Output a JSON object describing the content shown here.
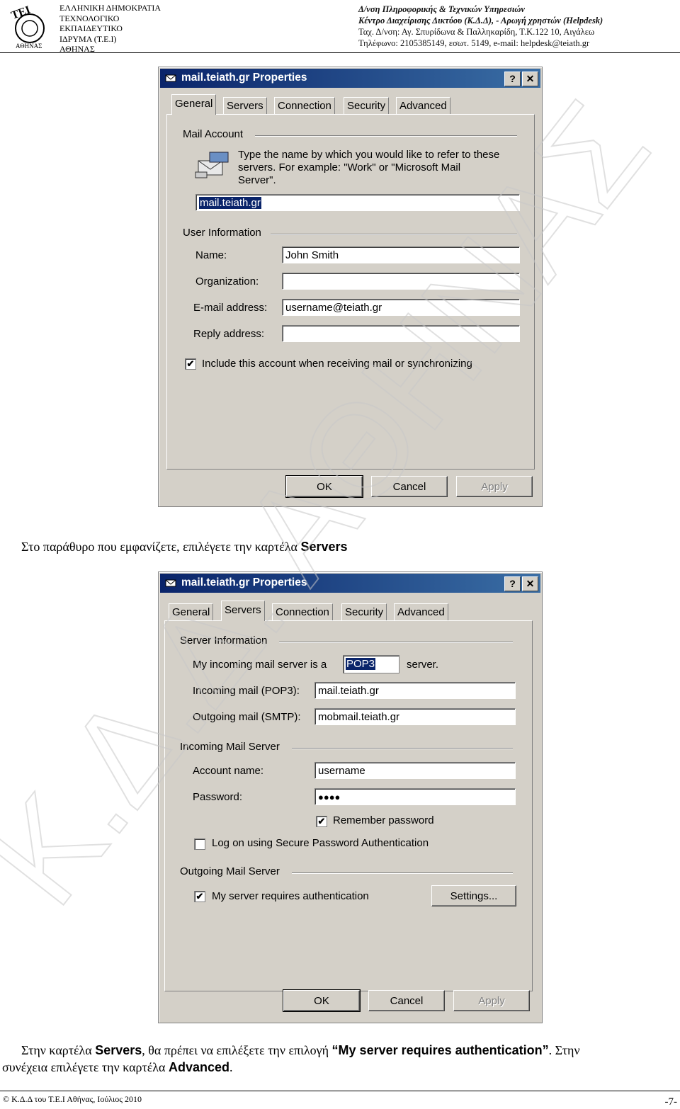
{
  "header": {
    "left_lines": [
      "ΕΛΛΗΝΙΚΗ ΔΗΜΟΚΡΑΤΙΑ",
      "ΤΕΧΝΟΛΟΓΙΚΟ",
      "ΕΚΠΑΙΔΕΥΤΙΚΟ",
      "ΙΔΡΥΜΑ (Τ.Ε.Ι)",
      "ΑΘΗΝΑΣ"
    ],
    "right_line1": "Δ/νση Πληροφορικής & Τεχνικών Υπηρεσιών",
    "right_line2": "Κέντρο Διαχείρισης Δικτύου (Κ.Δ.Δ), - Αρωγή χρηστών (Helpdesk)",
    "right_line3": "Ταχ. Δ/νση: Αγ. Σπυρίδωνα & Παλληκαρίδη, Τ.Κ.122 10, Αιγάλεω",
    "right_line4": "Τηλέφωνο: 2105385149, εσωτ. 5149,  e-mail: helpdesk@teiath.gr",
    "logo_text": "ΤΕΙ ΑΘΗΝΑΣ"
  },
  "watermark": "Κ.Δ.Δ. ΑΘΗΝΑΣ",
  "dialog1": {
    "title": "mail.teiath.gr Properties",
    "help_btn": "?",
    "close_btn": "✕",
    "tabs": [
      "General",
      "Servers",
      "Connection",
      "Security",
      "Advanced"
    ],
    "mail_account_group": "Mail Account",
    "description": [
      "Type the name by which you would like to refer to these",
      "servers.  For example: \"Work\" or \"Microsoft Mail",
      "Server\"."
    ],
    "account_name": "mail.teiath.gr",
    "user_info_group": "User Information",
    "labels": {
      "name": "Name:",
      "organization": "Organization:",
      "email": "E-mail address:",
      "reply": "Reply address:"
    },
    "values": {
      "name": "John Smith",
      "organization": "",
      "email": "username@teiath.gr",
      "reply": ""
    },
    "include_check": "✔",
    "include_label": "Include this account when receiving mail or synchronizing",
    "ok": "OK",
    "cancel": "Cancel",
    "apply": "Apply"
  },
  "para1": {
    "text": "Στο παράθυρο που εμφανίζετε, επιλέγετε την καρτέλα ",
    "bold": "Servers"
  },
  "dialog2": {
    "title": "mail.teiath.gr Properties",
    "help_btn": "?",
    "close_btn": "✕",
    "tabs": [
      "General",
      "Servers",
      "Connection",
      "Security",
      "Advanced"
    ],
    "server_info_group": "Server Information",
    "incoming_type_label": "My incoming mail server is a",
    "incoming_type": "POP3",
    "server_word": "server.",
    "incoming_label": "Incoming mail (POP3):",
    "incoming_value": "mail.teiath.gr",
    "outgoing_label": "Outgoing mail (SMTP):",
    "outgoing_value": "mobmail.teiath.gr",
    "incoming_server_group": "Incoming Mail Server",
    "account_label": "Account name:",
    "account_value": "username",
    "password_label": "Password:",
    "password_value": "●●●●",
    "remember_check": "✔",
    "remember_label": "Remember password",
    "spa_check": "",
    "spa_label": "Log on using Secure Password Authentication",
    "outgoing_server_group": "Outgoing Mail Server",
    "auth_check": "✔",
    "auth_label": "My server requires authentication",
    "settings": "Settings...",
    "ok": "OK",
    "cancel": "Cancel",
    "apply": "Apply"
  },
  "para2": {
    "t1": "Στην καρτέλα ",
    "b1": "Servers",
    "t2": ", θα πρέπει να επιλέξετε την επιλογή ",
    "b2": "“My server requires authentication”",
    "t3": ". Στην",
    "t4": "συνέχεια επιλέγετε την καρτέλα ",
    "b3": "Advanced",
    "t5": "."
  },
  "footer": {
    "left": "© Κ.Δ.Δ του Τ.Ε.Ι Αθήνας, Ιούλιος 2010",
    "right": "-7-"
  }
}
